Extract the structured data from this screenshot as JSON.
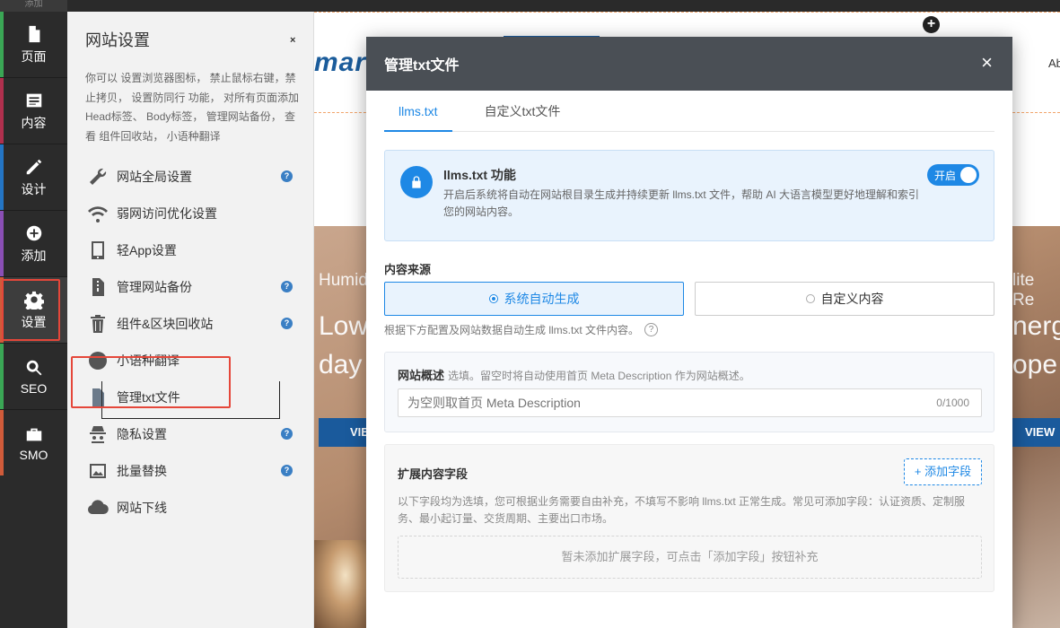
{
  "rail": {
    "top_label": "添加",
    "items": [
      {
        "label": "页面",
        "icon": "page-icon",
        "color": "#3aa655"
      },
      {
        "label": "内容",
        "icon": "content-icon",
        "color": "#b0304e"
      },
      {
        "label": "设计",
        "icon": "design-icon",
        "color": "#2475c4"
      },
      {
        "label": "添加",
        "icon": "add-icon",
        "color": "#8a4fb5"
      },
      {
        "label": "设置",
        "icon": "gear-icon",
        "color": "#d05b3a",
        "active": true
      },
      {
        "label": "SEO",
        "icon": "search-icon",
        "color": "#3aa655"
      },
      {
        "label": "SMO",
        "icon": "briefcase-icon",
        "color": "#d05b3a"
      }
    ]
  },
  "settings_panel": {
    "title": "网站设置",
    "close": "×",
    "description": "你可以 设置浏览器图标， 禁止鼠标右键，禁止拷贝， 设置防同行 功能， 对所有页面添加 Head标签、 Body标签， 管理网站备份， 查看 组件回收站， 小语种翻译",
    "items": [
      {
        "label": "网站全局设置",
        "icon": "wrench-icon",
        "help": true
      },
      {
        "label": "弱网访问优化设置",
        "icon": "wifi-icon",
        "help": false
      },
      {
        "label": "轻App设置",
        "icon": "app-icon",
        "help": false
      },
      {
        "label": "管理网站备份",
        "icon": "backup-file-icon",
        "help": true
      },
      {
        "label": "组件&区块回收站",
        "icon": "trash-icon",
        "help": true
      },
      {
        "label": "小语种翻译",
        "icon": "globe-icon",
        "help": false
      },
      {
        "label": "管理txt文件",
        "icon": "txt-file-icon",
        "help": false,
        "selected": true
      },
      {
        "label": "隐私设置",
        "icon": "spy-icon",
        "help": true
      },
      {
        "label": "批量替换",
        "icon": "image-replace-icon",
        "help": true
      },
      {
        "label": "网站下线",
        "icon": "cloud-download-icon",
        "help": false
      }
    ],
    "help_glyph": "?"
  },
  "site": {
    "logo_text": "mart",
    "nav_right": "Ab",
    "plus": "+",
    "hero_left_sub": "Humid",
    "hero_left_big_1": "Low",
    "hero_left_big_2": "day",
    "hero_left_btn": "VIEW",
    "hero_right_sub": "lite Re",
    "hero_right_big_1": "nerg",
    "hero_right_big_2": "ope",
    "hero_right_btn": "VIEW"
  },
  "modal": {
    "title": "管理txt文件",
    "close": "×",
    "tabs": [
      {
        "label": "llms.txt",
        "active": true
      },
      {
        "label": "自定义txt文件",
        "active": false
      }
    ],
    "feature": {
      "title": "llms.txt 功能",
      "description": "开启后系统将自动在网站根目录生成并持续更新 llms.txt 文件，帮助 AI 大语言模型更好地理解和索引您的网站内容。",
      "toggle_label": "开启",
      "enabled": true
    },
    "content_source": {
      "label": "内容来源",
      "options": [
        {
          "label": "系统自动生成",
          "selected": true
        },
        {
          "label": "自定义内容",
          "selected": false
        }
      ],
      "hint": "根据下方配置及网站数据自动生成 llms.txt 文件内容。",
      "hint_icon": "?"
    },
    "overview": {
      "label": "网站概述",
      "note": "选填。留空时将自动使用首页 Meta Description 作为网站概述。",
      "placeholder": "为空则取首页 Meta Description",
      "value": "",
      "counter": "0/1000"
    },
    "extended_fields": {
      "title": "扩展内容字段",
      "add_button": "+ 添加字段",
      "description": "以下字段均为选填，您可根据业务需要自由补充，不填写不影响 llms.txt 正常生成。常见可添加字段：认证资质、定制服务、最小起订量、交货周期、主要出口市场。",
      "empty_text": "暂未添加扩展字段，可点击「添加字段」按钮补充"
    }
  },
  "colors": {
    "accent": "#1e88e5",
    "highlight_red": "#e5473a",
    "modal_header": "#4a4f55"
  }
}
